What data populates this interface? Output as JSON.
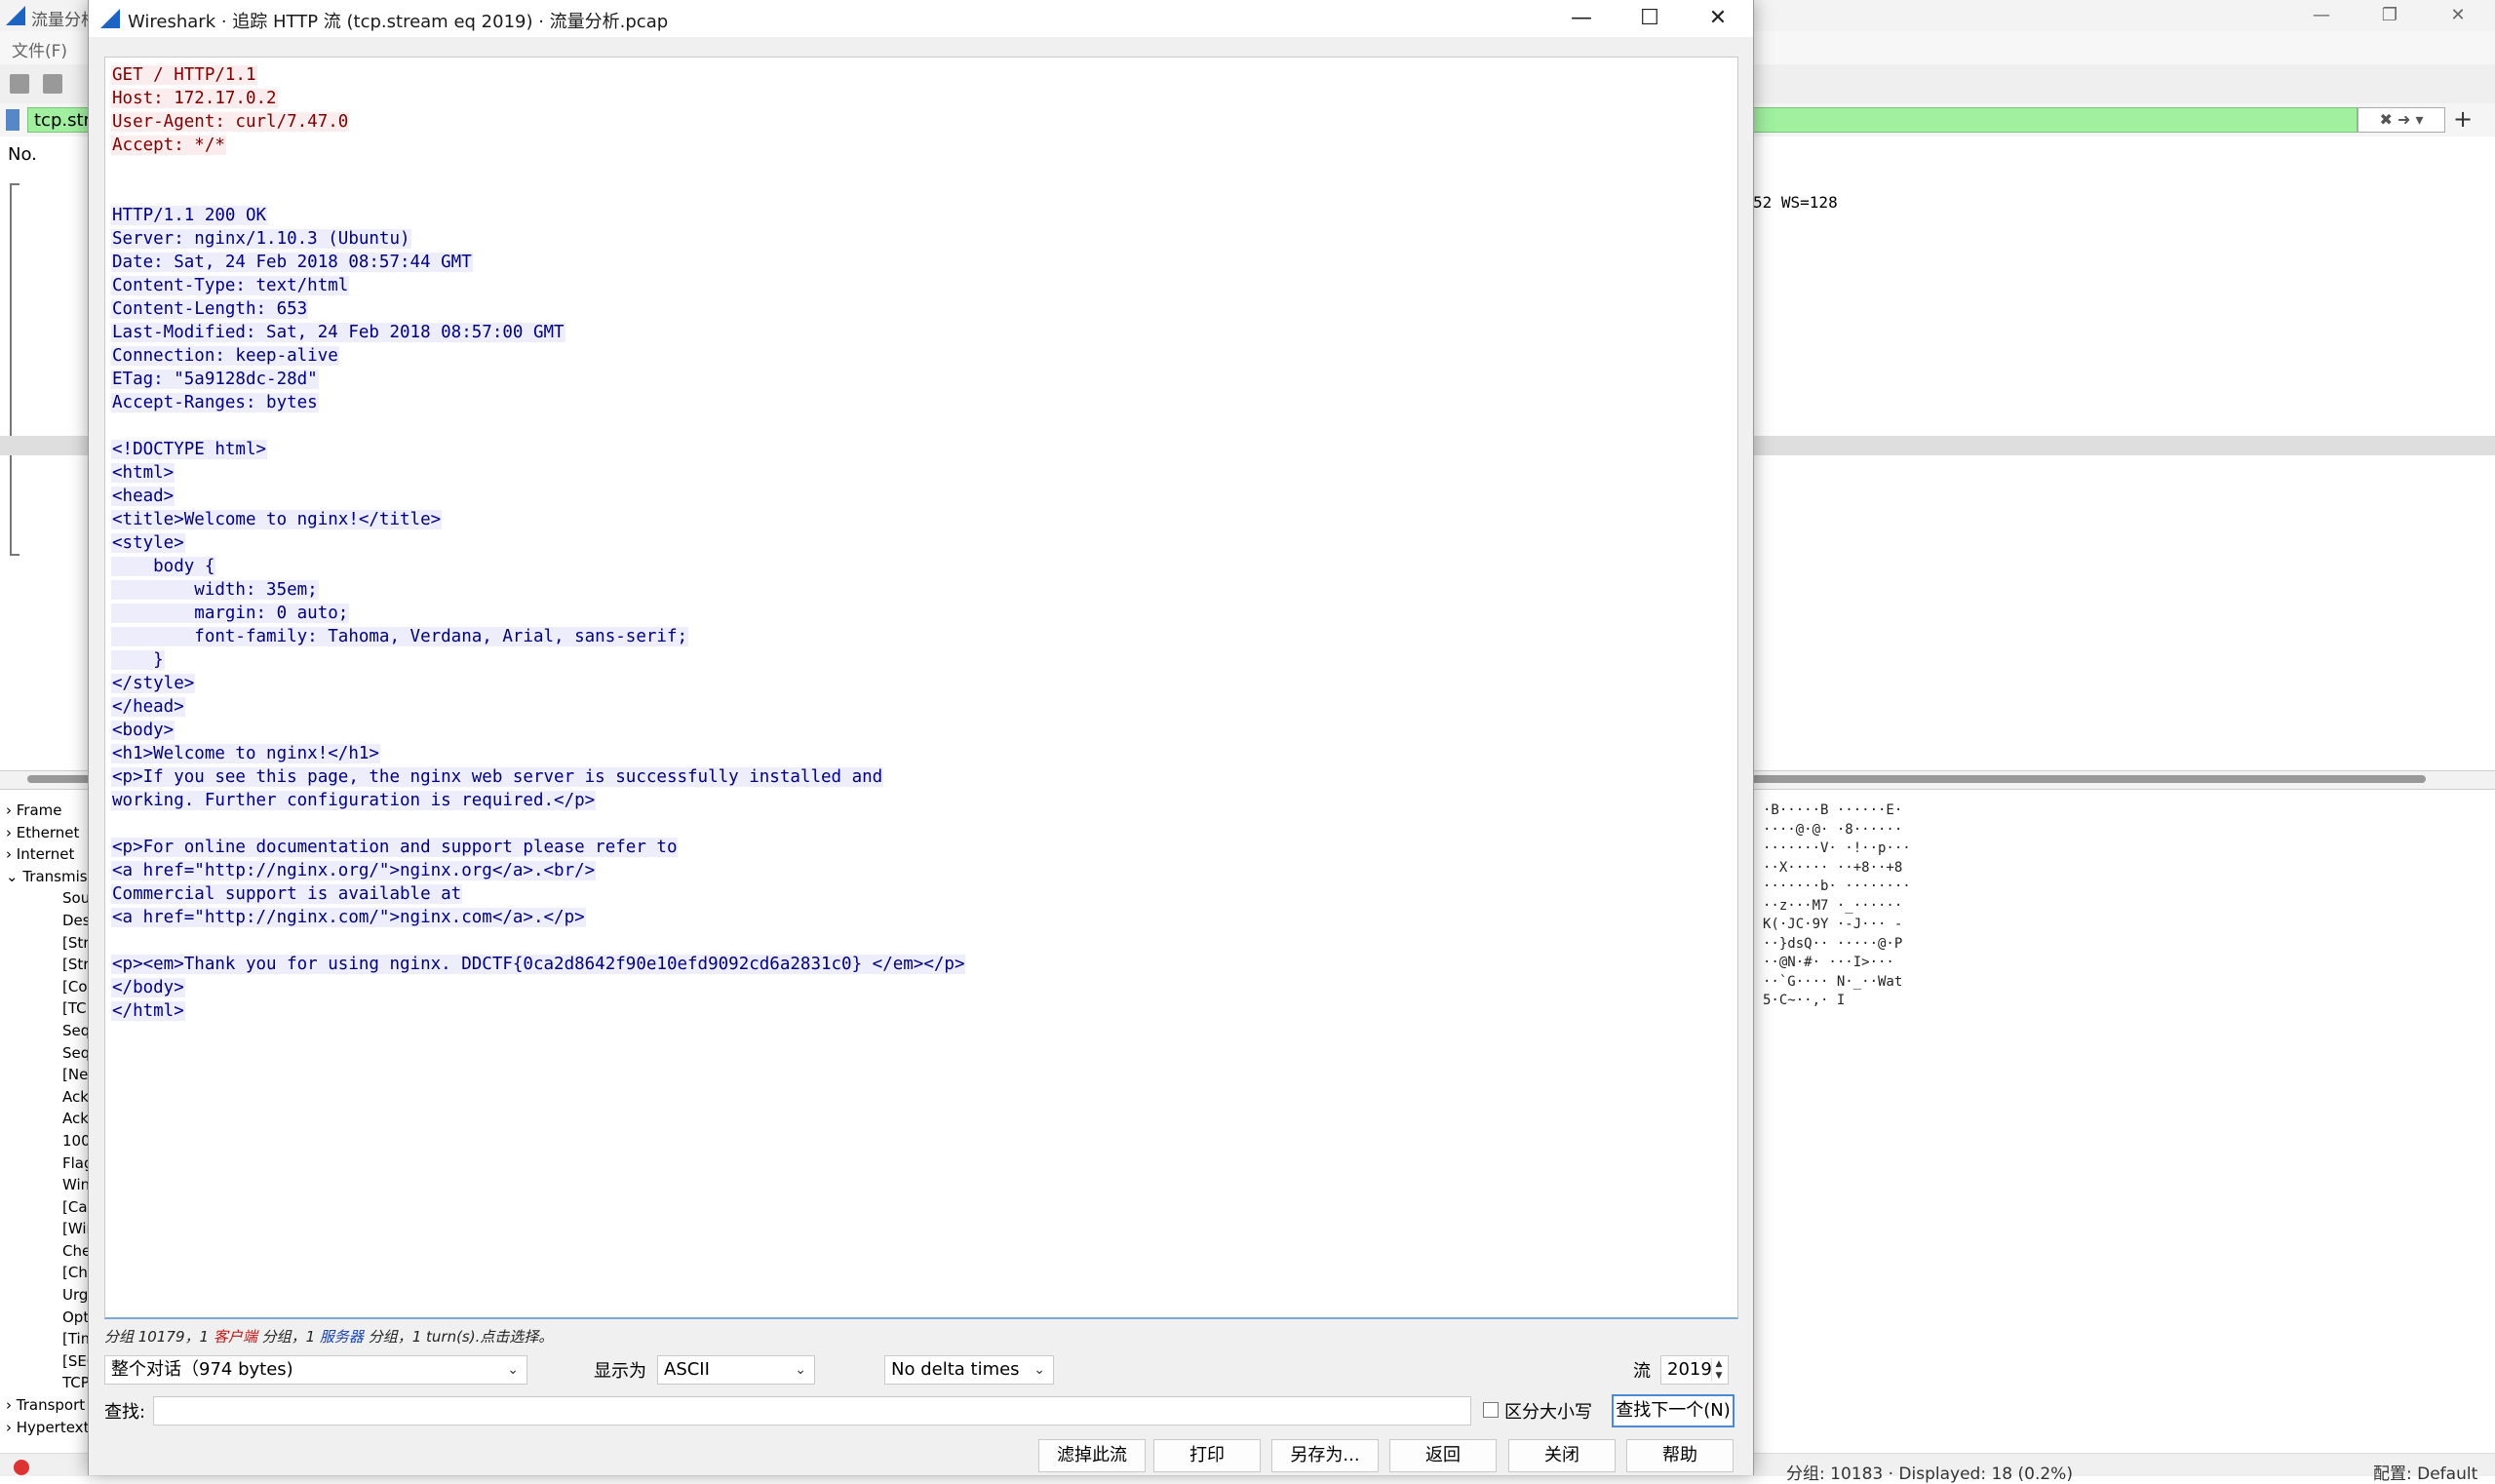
{
  "main_window": {
    "title": "流量分析",
    "menu_file": "文件(F)",
    "filter_text": "tcp.stream eq 2019",
    "col_no": "No.",
    "packet_info_fragment": "52 WS=128",
    "tree_items": [
      "Frame",
      "Ethernet",
      "Internet",
      "Transmission",
      "Source",
      "Destination",
      "[Stream]",
      "[Stream]",
      "[Conversation]",
      "[TCP]",
      "Sequence",
      "Sequence",
      "[Next]",
      "Acknowledgment",
      "Acknowledgment",
      "1000",
      "Flags",
      "Window",
      "[Calculated]",
      "[Window]",
      "Checksum",
      "[Checksum]",
      "Urgent",
      "Options",
      "[Timestamps]",
      "[SEQ/ACK]",
      "TCP",
      "Transport",
      "Hypertext"
    ],
    "hex_dump": "·B·····B ······E·\n····@·@· ·8······\n·······V· ·!··p···\n··X····· ··+8··+8\n·······b· ········\n··z···M7 ·_······\nK(·JC·9Y ·-J··· -\n··}dsQ·· ·····@·P\n··@N·#· ···I>···\n··`G···· N·_··Wat\n5·C~··,· I",
    "status_packets": "分组: 10183 · Displayed: 18 (0.2%)",
    "status_profile": "配置: Default"
  },
  "dialog": {
    "title": "Wireshark · 追踪 HTTP 流 (tcp.stream eq 2019) · 流量分析.pcap",
    "client_lines": [
      "GET / HTTP/1.1",
      "Host: 172.17.0.2",
      "User-Agent: curl/7.47.0",
      "Accept: */*"
    ],
    "server_lines": [
      "HTTP/1.1 200 OK",
      "Server: nginx/1.10.3 (Ubuntu)",
      "Date: Sat, 24 Feb 2018 08:57:44 GMT",
      "Content-Type: text/html",
      "Content-Length: 653",
      "Last-Modified: Sat, 24 Feb 2018 08:57:00 GMT",
      "Connection: keep-alive",
      "ETag: \"5a9128dc-28d\"",
      "Accept-Ranges: bytes",
      "",
      "<!DOCTYPE html>",
      "<html>",
      "<head>",
      "<title>Welcome to nginx!</title>",
      "<style>",
      "    body {",
      "        width: 35em;",
      "        margin: 0 auto;",
      "        font-family: Tahoma, Verdana, Arial, sans-serif;",
      "    }",
      "</style>",
      "</head>",
      "<body>",
      "<h1>Welcome to nginx!</h1>",
      "<p>If you see this page, the nginx web server is successfully installed and",
      "working. Further configuration is required.</p>",
      "",
      "<p>For online documentation and support please refer to",
      "<a href=\"http://nginx.org/\">nginx.org</a>.<br/>",
      "Commercial support is available at",
      "<a href=\"http://nginx.com/\">nginx.com</a>.</p>",
      "",
      "<p><em>Thank you for using nginx. DDCTF{0ca2d8642f90e10efd9092cd6a2831c0} </em></p>",
      "</body>",
      "</html>"
    ],
    "summary": {
      "part1": "分组 10179，1 ",
      "client": "客户端",
      "part2": " 分组，1 ",
      "server": "服务器",
      "part3": " 分组，1 turn(s).点击选择。"
    },
    "conversation_select": "整个对话（974 bytes)",
    "show_as_label": "显示为",
    "show_as_value": "ASCII",
    "delta_value": "No delta times",
    "stream_label": "流",
    "stream_value": "2019",
    "find_label": "查找:",
    "find_value": "",
    "case_label": "区分大小写",
    "find_next": "查找下一个(N)",
    "buttons": {
      "filter_out": "滤掉此流",
      "print": "打印",
      "save_as": "另存为...",
      "back": "返回",
      "close": "关闭",
      "help": "帮助"
    },
    "colors": {
      "client_fg": "#7f0000",
      "client_bg": "#fbeded",
      "server_fg": "#00007f",
      "server_bg": "#ededfb"
    }
  }
}
